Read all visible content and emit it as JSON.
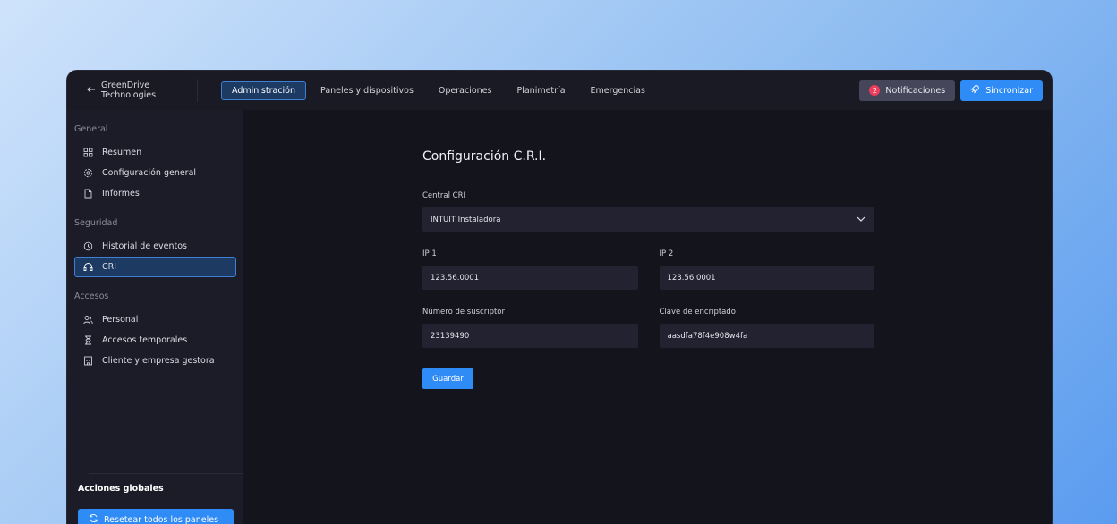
{
  "topbar": {
    "back_label": "GreenDrive Technologies",
    "nav": [
      {
        "label": "Administración",
        "active": true
      },
      {
        "label": "Paneles y dispositivos",
        "active": false
      },
      {
        "label": "Operaciones",
        "active": false
      },
      {
        "label": "Planimetría",
        "active": false
      },
      {
        "label": "Emergencias",
        "active": false
      }
    ],
    "notifications_label": "Notificaciones",
    "notifications_count": "2",
    "sync_label": "Sincronizar"
  },
  "sidebar": {
    "general_title": "General",
    "general_items": [
      {
        "label": "Resumen",
        "icon": "grid-icon"
      },
      {
        "label": "Configuración general",
        "icon": "gear-icon"
      },
      {
        "label": "Informes",
        "icon": "file-icon"
      }
    ],
    "security_title": "Seguridad",
    "security_items": [
      {
        "label": "Historial de eventos",
        "icon": "history-icon"
      },
      {
        "label": "CRI",
        "icon": "headset-icon",
        "active": true
      }
    ],
    "access_title": "Accesos",
    "access_items": [
      {
        "label": "Personal",
        "icon": "users-icon"
      },
      {
        "label": "Accesos temporales",
        "icon": "hourglass-icon"
      },
      {
        "label": "Cliente y empresa gestora",
        "icon": "building-icon"
      }
    ],
    "global_actions_title": "Acciones globales",
    "reset_label": "Resetear todos los paneles"
  },
  "form": {
    "title": "Configuración C.R.I.",
    "central_label": "Central CRI",
    "central_value": "INTUIT Instaladora",
    "ip1_label": "IP 1",
    "ip1_value": "123.56.0001",
    "ip2_label": "IP 2",
    "ip2_value": "123.56.0001",
    "subscriber_label": "Número de suscriptor",
    "subscriber_value": "23139490",
    "key_label": "Clave de encriptado",
    "key_value": "aasdfa78f4e908w4fa",
    "save_label": "Guardar"
  },
  "colors": {
    "accent": "#2f8bf5",
    "active_bg": "#1d3a63",
    "badge": "#ee3d5c"
  }
}
